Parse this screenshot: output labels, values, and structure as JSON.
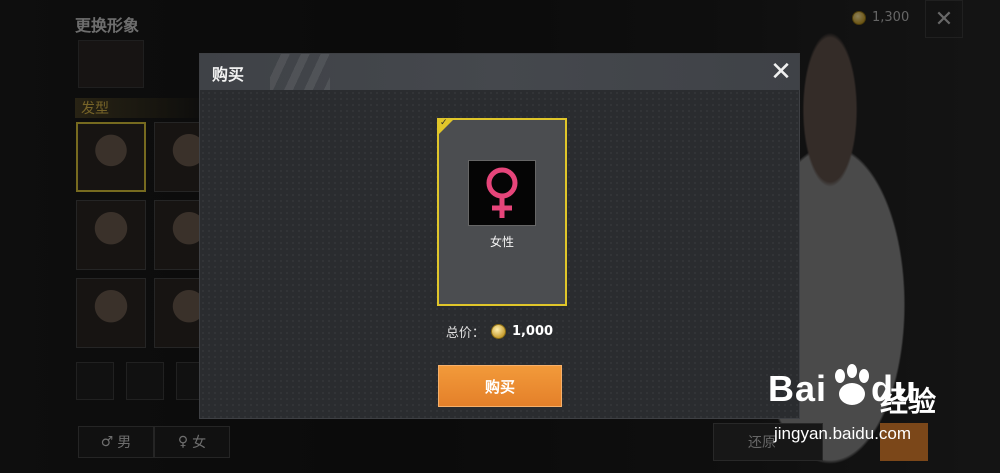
{
  "background": {
    "title": "更换形象",
    "section_label": "发型",
    "coins": "1,300",
    "close_glyph": "✕",
    "gender_tabs": [
      {
        "symbol": "♂",
        "label": "男"
      },
      {
        "symbol": "♀",
        "label": "女"
      }
    ],
    "restore_label": "还原"
  },
  "modal": {
    "title": "购买",
    "close_glyph": "✕",
    "item": {
      "icon": "female-symbol-icon",
      "label": "女性",
      "icon_color": "#e6457a"
    },
    "total_label": "总价：",
    "total_value": "1,000",
    "buy_label": "购买",
    "accent_color": "#e0c62a",
    "button_color": "#e4802a"
  },
  "watermark": {
    "logo_left": "Bai",
    "logo_right": "du",
    "suffix": "经验",
    "url": "jingyan.baidu.com"
  }
}
